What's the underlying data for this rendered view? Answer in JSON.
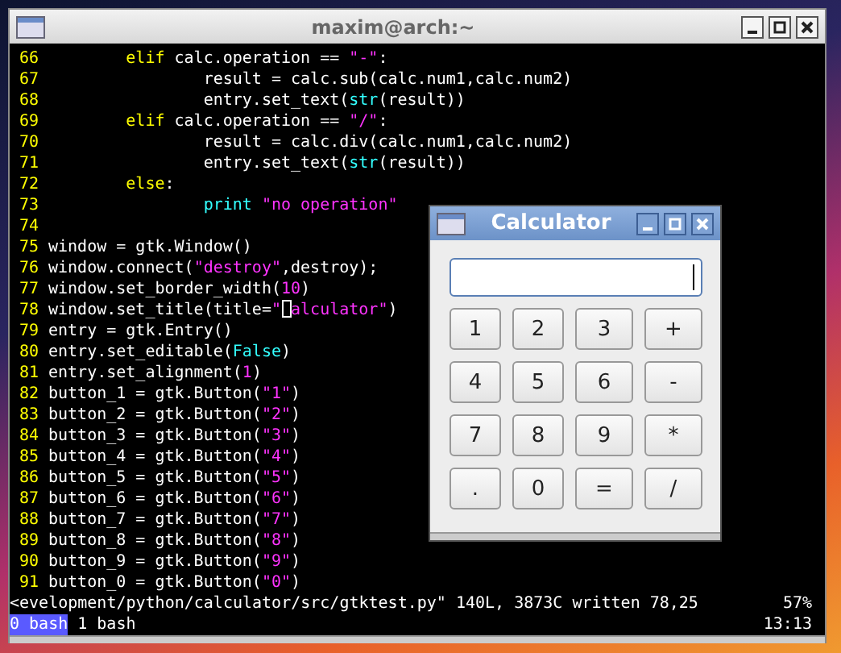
{
  "terminal": {
    "title": "maxim@arch:~",
    "lines": [
      {
        "number": "66",
        "tokens": [
          {
            "kind": "keyword",
            "text": "        elif"
          },
          {
            "kind": "plain",
            "text": " calc.operation == "
          },
          {
            "kind": "string",
            "text": "\"-\""
          },
          {
            "kind": "plain",
            "text": ":"
          }
        ]
      },
      {
        "number": "67",
        "tokens": [
          {
            "kind": "plain",
            "text": "                result = calc.sub(calc.num1,calc.num2)"
          }
        ]
      },
      {
        "number": "68",
        "tokens": [
          {
            "kind": "plain",
            "text": "                entry.set_text("
          },
          {
            "kind": "builtin",
            "text": "str"
          },
          {
            "kind": "plain",
            "text": "(result))"
          }
        ]
      },
      {
        "number": "69",
        "tokens": [
          {
            "kind": "keyword",
            "text": "        elif"
          },
          {
            "kind": "plain",
            "text": " calc.operation == "
          },
          {
            "kind": "string",
            "text": "\"/\""
          },
          {
            "kind": "plain",
            "text": ":"
          }
        ]
      },
      {
        "number": "70",
        "tokens": [
          {
            "kind": "plain",
            "text": "                result = calc.div(calc.num1,calc.num2)"
          }
        ]
      },
      {
        "number": "71",
        "tokens": [
          {
            "kind": "plain",
            "text": "                entry.set_text("
          },
          {
            "kind": "builtin",
            "text": "str"
          },
          {
            "kind": "plain",
            "text": "(result))"
          }
        ]
      },
      {
        "number": "72",
        "tokens": [
          {
            "kind": "keyword",
            "text": "        else"
          },
          {
            "kind": "plain",
            "text": ":"
          }
        ]
      },
      {
        "number": "73",
        "tokens": [
          {
            "kind": "builtin",
            "text": "                print"
          },
          {
            "kind": "string",
            "text": " \"no operation\""
          }
        ]
      },
      {
        "number": "74"
      },
      {
        "number": "75",
        "tokens": [
          {
            "kind": "plain",
            "text": "window = gtk.Window()"
          }
        ]
      },
      {
        "number": "76",
        "tokens": [
          {
            "kind": "plain",
            "text": "window.connect("
          },
          {
            "kind": "string",
            "text": "\"destroy\""
          },
          {
            "kind": "plain",
            "text": ",destroy);"
          }
        ]
      },
      {
        "number": "77",
        "tokens": [
          {
            "kind": "plain",
            "text": "window.set_border_width("
          },
          {
            "kind": "string",
            "text": "10"
          },
          {
            "kind": "plain",
            "text": ")"
          }
        ]
      },
      {
        "number": "78",
        "tokens": [
          {
            "kind": "plain",
            "text": "window.set_title(title="
          },
          {
            "kind": "string",
            "text": "\""
          },
          {
            "kind": "cursor"
          },
          {
            "kind": "string",
            "text": "alculator\""
          },
          {
            "kind": "plain",
            "text": ")"
          }
        ]
      },
      {
        "number": "79",
        "tokens": [
          {
            "kind": "plain",
            "text": "entry = gtk.Entry()"
          }
        ]
      },
      {
        "number": "80",
        "tokens": [
          {
            "kind": "plain",
            "text": "entry.set_editable("
          },
          {
            "kind": "builtin",
            "text": "False"
          },
          {
            "kind": "plain",
            "text": ")"
          }
        ]
      },
      {
        "number": "81",
        "tokens": [
          {
            "kind": "plain",
            "text": "entry.set_alignment("
          },
          {
            "kind": "string",
            "text": "1"
          },
          {
            "kind": "plain",
            "text": ")"
          }
        ]
      },
      {
        "number": "82",
        "tokens": [
          {
            "kind": "plain",
            "text": "button_1 = gtk.Button("
          },
          {
            "kind": "string",
            "text": "\"1\""
          },
          {
            "kind": "plain",
            "text": ")"
          }
        ]
      },
      {
        "number": "83",
        "tokens": [
          {
            "kind": "plain",
            "text": "button_2 = gtk.Button("
          },
          {
            "kind": "string",
            "text": "\"2\""
          },
          {
            "kind": "plain",
            "text": ")"
          }
        ]
      },
      {
        "number": "84",
        "tokens": [
          {
            "kind": "plain",
            "text": "button_3 = gtk.Button("
          },
          {
            "kind": "string",
            "text": "\"3\""
          },
          {
            "kind": "plain",
            "text": ")"
          }
        ]
      },
      {
        "number": "85",
        "tokens": [
          {
            "kind": "plain",
            "text": "button_4 = gtk.Button("
          },
          {
            "kind": "string",
            "text": "\"4\""
          },
          {
            "kind": "plain",
            "text": ")"
          }
        ]
      },
      {
        "number": "86",
        "tokens": [
          {
            "kind": "plain",
            "text": "button_5 = gtk.Button("
          },
          {
            "kind": "string",
            "text": "\"5\""
          },
          {
            "kind": "plain",
            "text": ")"
          }
        ]
      },
      {
        "number": "87",
        "tokens": [
          {
            "kind": "plain",
            "text": "button_6 = gtk.Button("
          },
          {
            "kind": "string",
            "text": "\"6\""
          },
          {
            "kind": "plain",
            "text": ")"
          }
        ]
      },
      {
        "number": "88",
        "tokens": [
          {
            "kind": "plain",
            "text": "button_7 = gtk.Button("
          },
          {
            "kind": "string",
            "text": "\"7\""
          },
          {
            "kind": "plain",
            "text": ")"
          }
        ]
      },
      {
        "number": "89",
        "tokens": [
          {
            "kind": "plain",
            "text": "button_8 = gtk.Button("
          },
          {
            "kind": "string",
            "text": "\"8\""
          },
          {
            "kind": "plain",
            "text": ")"
          }
        ]
      },
      {
        "number": "90",
        "tokens": [
          {
            "kind": "plain",
            "text": "button_9 = gtk.Button("
          },
          {
            "kind": "string",
            "text": "\"9\""
          },
          {
            "kind": "plain",
            "text": ")"
          }
        ]
      },
      {
        "number": "91",
        "tokens": [
          {
            "kind": "plain",
            "text": "button_0 = gtk.Button("
          },
          {
            "kind": "string",
            "text": "\"0\""
          },
          {
            "kind": "plain",
            "text": ")"
          }
        ]
      }
    ],
    "status_line": {
      "message": "<evelopment/python/calculator/src/gtktest.py\" 140L, 3873C written 78,25",
      "percent": "57%"
    },
    "tabs": [
      {
        "label": "0 bash",
        "selected": true
      },
      {
        "label": "1 bash",
        "selected": false
      }
    ],
    "clock": "13:13"
  },
  "calculator": {
    "title": "Calculator",
    "buttons": [
      "1",
      "2",
      "3",
      "+",
      "4",
      "5",
      "6",
      "-",
      "7",
      "8",
      "9",
      "*",
      ".",
      "0",
      "=",
      "/"
    ]
  }
}
